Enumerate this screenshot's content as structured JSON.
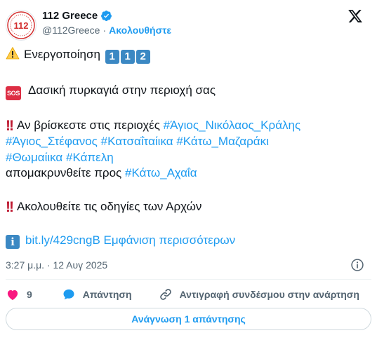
{
  "header": {
    "display_name": "112 Greece",
    "handle": "@112Greece",
    "separator": "·",
    "follow_label": "Ακολουθήστε",
    "avatar_text": "112"
  },
  "tweet": {
    "line1_text": "Ενεργοποίηση",
    "line1_keys": [
      "1",
      "1",
      "2"
    ],
    "sos_label": "SOS",
    "line2_text": "Δασική πυρκαγιά στην περιοχή σας",
    "line3_text": "Αν βρίσκεστε στις περιοχές",
    "hashtags": [
      "#Άγιος_Νικόλαος_Κράλης",
      "#Άγιος_Στέφανος",
      "#Κατσαΐταίικα",
      "#Κάτω_Μαζαράκι",
      "#Θωμαίικα",
      "#Κάπελη"
    ],
    "line4_text": "απομακρυνθείτε προς",
    "hashtag_destination": "#Κάτω_Αχαΐα",
    "line5_text": "Ακολουθείτε τις οδηγίες των Αρχών",
    "info_label": "i",
    "link": "bit.ly/429cngB",
    "show_more": "Εμφάνιση περισσότερων"
  },
  "meta": {
    "timestamp": "3:27 μ.μ. · 12 Αυγ 2025"
  },
  "actions": {
    "like_count": "9",
    "reply_label": "Απάντηση",
    "copy_label": "Αντιγραφή συνδέσμου στην ανάρτηση"
  },
  "read_replies_label": "Ανάγνωση 1 απάντησης",
  "colors": {
    "accent": "#1d9bf0",
    "text": "#0f1419",
    "muted": "#536471",
    "like": "#f91880",
    "sos": "#dd2e44",
    "keycap": "#3b88c3"
  }
}
